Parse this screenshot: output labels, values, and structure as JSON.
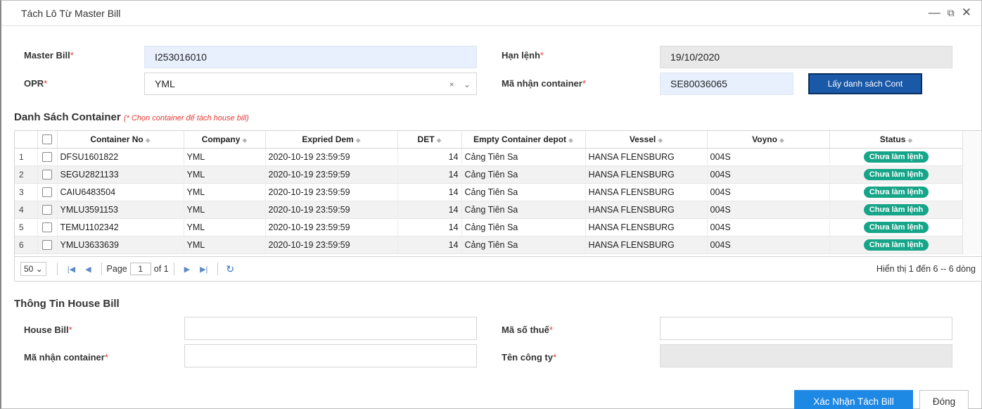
{
  "dialog": {
    "title": "Tách Lô Từ Master Bill",
    "icons": [
      "minimize-icon",
      "maximize-icon",
      "close-icon"
    ]
  },
  "form": {
    "master_bill_label": "Master Bill",
    "master_bill_value": "I253016010",
    "opr_label": "OPR",
    "opr_value": "YML",
    "han_lenh_label": "Hạn lệnh",
    "han_lenh_value": "19/10/2020",
    "ma_nhan_label": "Mã nhận container",
    "ma_nhan_value": "SE80036065",
    "fetch_button": "Lấy danh sách Cont",
    "required_mark": "*",
    "clear_icon": "×",
    "dropdown_icon": "⌄"
  },
  "container_section": {
    "title": "Danh Sách Container",
    "hint": "(* Chọn container để tách house bill)"
  },
  "grid": {
    "columns": [
      "Container No",
      "Company",
      "Expried Dem",
      "DET",
      "Empty Container depot",
      "Vessel",
      "Voyno",
      "Status"
    ],
    "rows": [
      {
        "no": "1",
        "container": "DFSU1601822",
        "company": "YML",
        "dem": "2020-10-19 23:59:59",
        "det": "14",
        "depot": "Cảng Tiên Sa",
        "vessel": "HANSA FLENSBURG",
        "voyno": "004S",
        "status": "Chưa làm lệnh"
      },
      {
        "no": "2",
        "container": "SEGU2821133",
        "company": "YML",
        "dem": "2020-10-19 23:59:59",
        "det": "14",
        "depot": "Cảng Tiên Sa",
        "vessel": "HANSA FLENSBURG",
        "voyno": "004S",
        "status": "Chưa làm lệnh"
      },
      {
        "no": "3",
        "container": "CAIU6483504",
        "company": "YML",
        "dem": "2020-10-19 23:59:59",
        "det": "14",
        "depot": "Cảng Tiên Sa",
        "vessel": "HANSA FLENSBURG",
        "voyno": "004S",
        "status": "Chưa làm lệnh"
      },
      {
        "no": "4",
        "container": "YMLU3591153",
        "company": "YML",
        "dem": "2020-10-19 23:59:59",
        "det": "14",
        "depot": "Cảng Tiên Sa",
        "vessel": "HANSA FLENSBURG",
        "voyno": "004S",
        "status": "Chưa làm lệnh"
      },
      {
        "no": "5",
        "container": "TEMU1102342",
        "company": "YML",
        "dem": "2020-10-19 23:59:59",
        "det": "14",
        "depot": "Cảng Tiên Sa",
        "vessel": "HANSA FLENSBURG",
        "voyno": "004S",
        "status": "Chưa làm lệnh"
      },
      {
        "no": "6",
        "container": "YMLU3633639",
        "company": "YML",
        "dem": "2020-10-19 23:59:59",
        "det": "14",
        "depot": "Cảng Tiên Sa",
        "vessel": "HANSA FLENSBURG",
        "voyno": "004S",
        "status": "Chưa làm lệnh"
      }
    ],
    "status_color": "#17a589"
  },
  "pager": {
    "page_size": "50",
    "page_label": "Page",
    "page_value": "1",
    "of_label": "of 1",
    "info": "Hiển thị 1 đến 6 -- 6 dòng"
  },
  "house_section": {
    "title": "Thông Tin House Bill",
    "house_bill_label": "House Bill",
    "house_bill_value": "",
    "ma_so_thue_label": "Mã số thuế",
    "ma_so_thue_value": "",
    "ma_nhan_label": "Mã nhận container",
    "ma_nhan_value": "",
    "ten_cong_ty_label": "Tên công ty",
    "ten_cong_ty_value": ""
  },
  "footer": {
    "confirm_button": "Xác Nhận Tách Bill",
    "close_button": "Đóng"
  },
  "colors": {
    "primary": "#1e88e5",
    "required": "#e53935",
    "badge": "#17a589"
  }
}
